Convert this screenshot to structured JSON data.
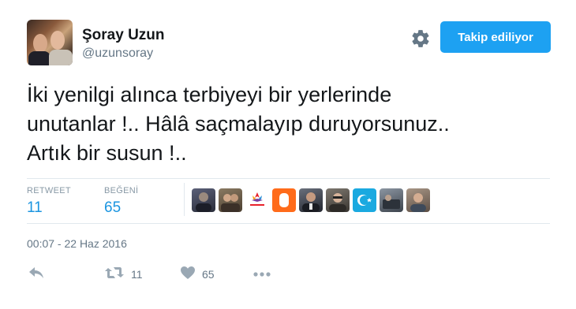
{
  "author": {
    "name": "Şoray Uzun",
    "handle": "@uzunsoray"
  },
  "follow_button": {
    "label": "Takip ediliyor"
  },
  "tweet": {
    "text": "İki yenilgi alınca terbiyeyi bir yerlerinde\nunutanlar !.. Hâlâ saçmalayıp duruyorsunuz..\nArtık bir susun !.."
  },
  "stats": {
    "retweet_label": "RETWEET",
    "retweet_count": "11",
    "like_label": "BEĞENİ",
    "like_count": "65"
  },
  "likers": [
    {
      "icon": "avatar-icon",
      "color": "#3b3f52"
    },
    {
      "icon": "avatar-icon",
      "color": "#6b5a44"
    },
    {
      "icon": "bizimbilgi-logo-icon",
      "color": "#ffffff"
    },
    {
      "icon": "avatar-icon",
      "color": "#ff6b1a"
    },
    {
      "icon": "avatar-icon",
      "color": "#2b2f3a"
    },
    {
      "icon": "avatar-icon",
      "color": "#55504a"
    },
    {
      "icon": "flag-icon",
      "color": "#1aa9e0"
    },
    {
      "icon": "avatar-icon",
      "color": "#4d5560"
    },
    {
      "icon": "avatar-icon",
      "color": "#7a6c62"
    }
  ],
  "timestamp": "00:07 - 22 Haz 2016",
  "actions": {
    "reply_icon": "reply-icon",
    "retweet_icon": "retweet-icon",
    "retweet_count": "11",
    "like_icon": "heart-icon",
    "like_count": "65",
    "more_icon": "more-icon"
  },
  "colors": {
    "accent": "#1da1f2",
    "stat_value": "#1b95e0",
    "muted": "#657786",
    "divider": "#e1e8ed"
  }
}
